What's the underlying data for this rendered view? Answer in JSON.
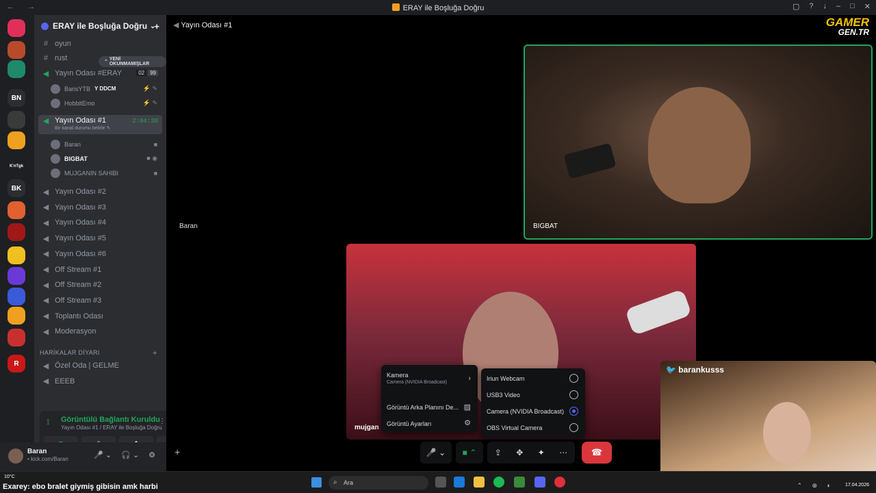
{
  "window": {
    "title": "ERAY ile Boşluğa Doğru",
    "nav_icons": "← →",
    "controls": [
      "▢",
      "?",
      "↓",
      "–",
      "□",
      "✕"
    ]
  },
  "guilds": [
    {
      "label": "",
      "color": "#e0305a"
    },
    {
      "label": "",
      "color": "#b84a2a"
    },
    {
      "label": "",
      "color": "#1f8a6a"
    },
    {
      "label": "BN",
      "color": "#2b2d31"
    },
    {
      "label": "",
      "color": "#3a3a3a"
    },
    {
      "label": "",
      "color": "#f0a020"
    },
    {
      "label": "K'nTgk",
      "color": "#1e1f22"
    },
    {
      "label": "BK",
      "color": "#2b2d31"
    },
    {
      "label": "",
      "color": "#e06030"
    },
    {
      "label": "",
      "color": "#a01818"
    },
    {
      "label": "",
      "color": "#f0c020"
    },
    {
      "label": "",
      "color": "#6a3ad8"
    },
    {
      "label": "",
      "color": "#3a5ad8"
    },
    {
      "label": "",
      "color": "#f0a020"
    },
    {
      "label": "",
      "color": "#c83030"
    },
    {
      "label": "R",
      "color": "#c81818"
    }
  ],
  "server": {
    "name": "ERAY ile Boşluğa Doğru",
    "chevron": "⌄",
    "invite_icon": "+"
  },
  "unread_pill": "YENİ OKUNMAMIŞLAR",
  "channels": {
    "oyun": "oyun",
    "rust": "rust",
    "eray": {
      "name": "Yayın Odası #ERAY",
      "count_a": "02",
      "count_b": "99"
    },
    "eray_users": [
      {
        "name": "BarisYTB",
        "tag": "Y DDCM",
        "icons": "⚡ ✎"
      },
      {
        "name": "HobbitEmo",
        "tag": "",
        "icons": "⚡ ✎"
      }
    ],
    "active": {
      "name": "Yayın Odası #1",
      "sub": "Bir kanal durumu belirle ✎",
      "timer": "2:04:30"
    },
    "active_users": [
      {
        "name": "Baran",
        "icons": "■"
      },
      {
        "name": "BIGBAT",
        "icons": "■ ◉"
      },
      {
        "name": "MUJGANIN SAHIBI",
        "icons": "■"
      }
    ],
    "rest": [
      "Yayın Odası #2",
      "Yayın Odası #3",
      "Yayın Odası #4",
      "Yayın Odası #5",
      "Yayın Odası #6",
      "Off Stream #1",
      "Off Stream #2",
      "Off Stream #3",
      "Toplantı Odası",
      "Moderasyon"
    ],
    "category": "HARİKALAR DİYARI",
    "category_add": "+",
    "cat_channels": [
      "Özel Oda | GELME",
      "EEEB"
    ]
  },
  "voice_panel": {
    "status": "Görüntülü Bağlantı Kuruldu",
    "sub": "Yayın Odası #1 / ERAY ile Boşluğa Doğru",
    "buttons": [
      "■",
      "⇪",
      "✥",
      "✦"
    ]
  },
  "account": {
    "name": "Baran",
    "status": "• kick.com/Baran",
    "controls": [
      "🎤 ⌄",
      "🎧 ⌄",
      "⚙"
    ]
  },
  "stage": {
    "channel": "Yayın Odası #1",
    "baran_label": "Baran",
    "bigbat_label": "BIGBAT",
    "center_label": "mujgan",
    "watermark_1": "GAMER",
    "watermark_2": "GEN.TR",
    "twitter": "🐦 barankusss",
    "add_user_icon": "+"
  },
  "menu_camera": {
    "title": "Kamera",
    "sub": "Camera (NVIDIA Broadcast)",
    "items": [
      "Görüntü Arka Planını De...",
      "Görüntü Ayarları"
    ],
    "arrow": "›"
  },
  "menu_devices": {
    "items": [
      {
        "label": "Iriun Webcam",
        "selected": false
      },
      {
        "label": "USB3 Video",
        "selected": false
      },
      {
        "label": "Camera (NVIDIA Broadcast)",
        "selected": true
      },
      {
        "label": "OBS Virtual Camera",
        "selected": false
      }
    ]
  },
  "controls": {
    "mic": "🎤 ⌄",
    "cam": "■ ⌃",
    "share": "⇪",
    "activity": "✥",
    "sound": "✦",
    "more": "⋯",
    "hang": "☎"
  },
  "taskbar": {
    "weather": "10°C",
    "caption": "Exarey: ebo bralet giymiş gibisin amk harbi",
    "search": "Ara",
    "date": "17.04.2026",
    "tray": "⌃ ⊕ ◐"
  }
}
